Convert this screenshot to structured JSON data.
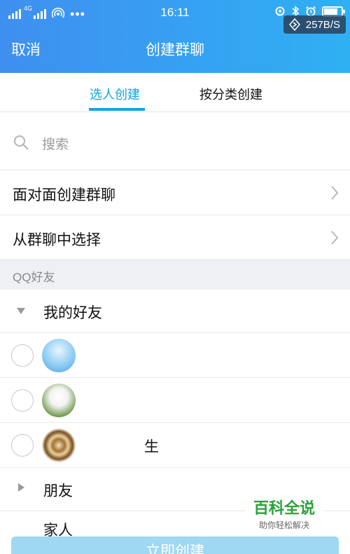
{
  "status_bar": {
    "time": "16:11",
    "network_type": "4G",
    "net_speed": "257B/S",
    "more_dots": "•••"
  },
  "header": {
    "cancel_label": "取消",
    "title": "创建群聊"
  },
  "tabs": [
    {
      "label": "选人创建",
      "active": true
    },
    {
      "label": "按分类创建",
      "active": false
    }
  ],
  "search": {
    "placeholder": "搜索"
  },
  "menu_rows": [
    {
      "label": "面对面创建群聊"
    },
    {
      "label": "从群聊中选择"
    }
  ],
  "section_header": "QQ好友",
  "groups": [
    {
      "label": "我的好友",
      "expanded": true
    },
    {
      "label": "朋友",
      "expanded": false
    }
  ],
  "friends": [
    {
      "name": "",
      "checked": false
    },
    {
      "name": "",
      "checked": false
    },
    {
      "name": "生",
      "checked": false
    }
  ],
  "next_group_peek": "家人",
  "confirm_button": "立即创建",
  "watermark": {
    "title": "百科全说",
    "subtitle": "助你轻松解决"
  },
  "colors": {
    "header_gradient_start": "#3f8ff0",
    "header_gradient_end": "#2fb0f3",
    "accent": "#12a4e3",
    "confirm_disabled": "#9fd8f3",
    "section_bg": "#eef0f3"
  }
}
